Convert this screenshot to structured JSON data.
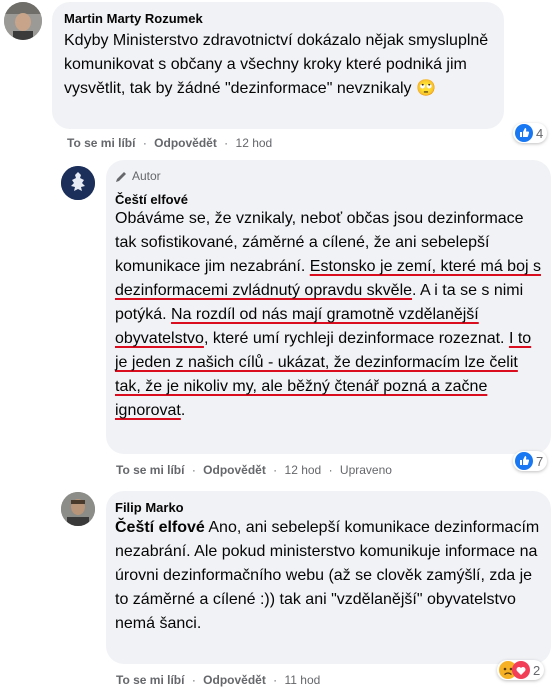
{
  "comments": [
    {
      "author": "Martin Marty Rozumek",
      "text": "Kdyby Ministerstvo zdravotnictví dokázalo nějak smysluplně komunikovat s občany a všechny kroky které podniká jim vysvětlit, tak by žádné \"dezinformace\" nevznikaly",
      "emoji": "🙄",
      "actions": {
        "like": "To se mi líbí",
        "reply": "Odpovědět",
        "time": "12 hod"
      },
      "reactions": {
        "icon": "like-icon",
        "count": "4"
      }
    },
    {
      "badge": "Autor",
      "author": "Čeští elfové",
      "text_parts": [
        {
          "text": "Obáváme se, že vznikaly, neboť občas jsou dezinformace tak sofistikované, záměrné a cílené, že ani sebelepší komunikace jim nezabrání. ",
          "underline": false
        },
        {
          "text": "Estonsko je zemí, které má boj s dezinformacemi zvládnutý opravdu skvěle",
          "underline": true
        },
        {
          "text": ". A i ta se s nimi potýká. ",
          "underline": false
        },
        {
          "text": "Na rozdíl od nás mají gramotně vzdělanější obyvatelstvo",
          "underline": true
        },
        {
          "text": ", které umí rychleji dezinformace rozeznat. ",
          "underline": false
        },
        {
          "text": "I to je jeden z našich cílů - ukázat, že dezinformacím lze čelit tak, že je nikoliv my, ale běžný čtenář pozná a začne ignorovat",
          "underline": true
        },
        {
          "text": ".",
          "underline": false
        }
      ],
      "actions": {
        "like": "To se mi líbí",
        "reply": "Odpovědět",
        "time": "12 hod",
        "edited": "Upraveno"
      },
      "reactions": {
        "icon": "like-icon",
        "count": "7"
      }
    },
    {
      "author": "Filip Marko",
      "mention": "Čeští elfové",
      "text": "Ano, ani sebelepší komunikace dezinformacím nezabrání. Ale pokud ministerstvo komunikuje informace na úrovni dezinformačního webu (až se clověk zamýšlí, zda je to záměrné a cílené :)) tak ani \"vzdělanější\" obyvatelstvo nemá šanci.",
      "actions": {
        "like": "To se mi líbí",
        "reply": "Odpovědět",
        "time": "11 hod"
      },
      "reactions": {
        "icon": "sad-icon",
        "count": "2"
      }
    }
  ],
  "separator": "·",
  "colors": {
    "like_blue": "#1877f2",
    "underline_red": "#d90d1e",
    "bubble": "#f0f2f5",
    "meta": "#65676b"
  }
}
